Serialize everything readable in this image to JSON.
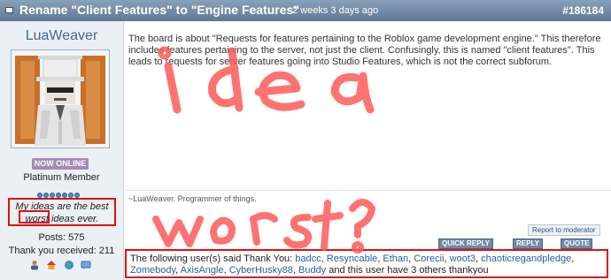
{
  "header": {
    "title": "Rename \"Client Features\" to \"Engine Features\"",
    "time": "2 weeks 3 days ago",
    "post_id": "#186184"
  },
  "user": {
    "username": "LuaWeaver",
    "status_badge": "NOW ONLINE",
    "rank": "Platinum Member",
    "signature_pre": "My ideas are the best",
    "signature_highlight": "worst",
    "signature_post": "ideas ever.",
    "posts": "Posts: 575",
    "thanks_received": "Thank you received: 211",
    "icons": [
      "user-icon",
      "home-icon",
      "globe-icon",
      "message-icon"
    ]
  },
  "post": {
    "body": "The board is about \"Requests for features pertaining to the Roblox game development engine.\" This therefore includes features pertaining to the server, not just the client. Confusingly, this is named \"client features\". This leads to requests for server features going into Studio Features, which is not the correct subforum.",
    "signature": "~LuaWeaver. Programmer of things."
  },
  "actions": {
    "report": "Report to moderator",
    "quick_reply": "QUICK REPLY",
    "reply": "REPLY",
    "quote": "QUOTE"
  },
  "thanks": {
    "prefix": "The following user(s) said Thank You:",
    "users": [
      "badcc",
      "Resyncable",
      "Ethan",
      "Corecii",
      "woot3",
      "chaoticregandpledge",
      "Zomebody",
      "AxisAngle",
      "CyberHusky88",
      "Buddy"
    ],
    "suffix": "and this user have 3 others thankyou"
  },
  "annotations": {
    "scrawl1": "idea",
    "scrawl2": "worst?",
    "color": "#ff5555"
  }
}
